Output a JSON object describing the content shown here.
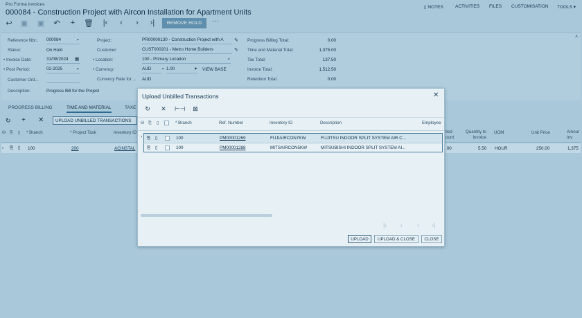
{
  "header": {
    "breadcrumb": "Pro Forma Invoices",
    "title": "000084 - Construction Project with Aircon Installation for Apartment Units",
    "menu": [
      "NOTES",
      "ACTIVITIES",
      "FILES",
      "CUSTOMISATION",
      "TOOLS"
    ]
  },
  "toolbar": {
    "remove_hold": "REMOVE HOLD",
    "more": "···"
  },
  "form": {
    "ref_label": "Reference Nbr.:",
    "ref_value": "000084",
    "status_label": "Status:",
    "status_value": "On Hold",
    "invoice_date_label": "Invoice Date:",
    "invoice_date_value": "31/08/2024",
    "post_period_label": "Post Period:",
    "post_period_value": "02-2025",
    "customer_ord_label": "Customer Ord...",
    "description_label": "Description:",
    "description_value": "Progress Bill for the Project",
    "project_label": "Project:",
    "project_value": "PR00000130 - Construction Project with A",
    "customer_label": "Customer:",
    "customer_value": "CUST000201 - Metro Home Builders",
    "location_label": "Location:",
    "location_value": "100 - Primary Location",
    "currency_label": "Currency:",
    "currency_value": "AUD",
    "currency_rate": "1.00",
    "view_base": "VIEW BASE",
    "currency_rate_label": "Currency Rate for ...",
    "currency_rate_value": "AUD",
    "progress_total_label": "Progress Billing Total:",
    "progress_total_value": "0.00",
    "tm_total_label": "Time and Material Total:",
    "tm_total_value": "1,375.00",
    "tax_total_label": "Tax Total:",
    "tax_total_value": "137.50",
    "invoice_total_label": "Invoice Total:",
    "invoice_total_value": "1,512.50",
    "retention_total_label": "Retention Total:",
    "retention_total_value": "0.00"
  },
  "tabs": [
    "PROGRESS BILLING",
    "TIME AND MATERIAL",
    "TAXE"
  ],
  "grid": {
    "upload_button": "UPLOAD UNBILLED TRANSACTIONS",
    "headers": {
      "branch": "Branch",
      "project_task": "Project Task",
      "inventory_id": "Inventory ID",
      "billed_amount": "lled\nount",
      "qty_to_invoice": "Quantity to\nInvoice",
      "uom": "UOM",
      "unit_price": "Unit Price",
      "amount": "Amour\nInv"
    },
    "row": {
      "branch": "100",
      "project_task": "200",
      "inventory_id": "ACINSTAL",
      "billed": ".00",
      "qty": "5.50",
      "uom": "HOUR",
      "unit_price": "250.00",
      "amount": "1,375"
    }
  },
  "modal": {
    "title": "Upload Unbilled Transactions",
    "headers": {
      "branch": "Branch",
      "ref_number": "Ref. Number",
      "inventory_id": "Inventory ID",
      "description": "Description",
      "employee": "Employee"
    },
    "rows": [
      {
        "branch": "100",
        "ref": "PM00001269",
        "inventory": "FUJIAIRCON7KW",
        "description": "FUJITSU INDOOR SPLIT SYSTEM AIR C..."
      },
      {
        "branch": "100",
        "ref": "PM00001288",
        "inventory": "MITSAIRCON5KW",
        "description": "MITSUBISHI INDOOR SPLIT SYSTEM AI..."
      }
    ],
    "buttons": {
      "upload": "UPLOAD",
      "upload_close": "UPLOAD & CLOSE",
      "close": "CLOSE"
    }
  }
}
